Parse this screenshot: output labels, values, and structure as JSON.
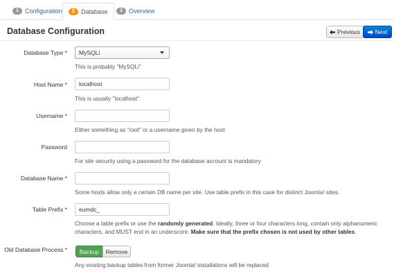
{
  "tabs": [
    {
      "number": "1",
      "label": "Configuration"
    },
    {
      "number": "2",
      "label": "Database"
    },
    {
      "number": "3",
      "label": "Overview"
    }
  ],
  "active_tab": "Database",
  "header": {
    "title": "Database Configuration",
    "previous_label": "Previous",
    "next_label": "Next"
  },
  "form": {
    "database_type": {
      "label": "Database Type *",
      "value": "MySQLi",
      "help": "This is probably \"MySQLi\""
    },
    "host_name": {
      "label": "Host Name *",
      "value": "localhost",
      "help": "This is usually \"localhost\""
    },
    "username": {
      "label": "Username *",
      "value": "",
      "help": "Either something as \"root\" or a username given by the host"
    },
    "password": {
      "label": "Password",
      "value": "",
      "help": "For site security using a password for the database account is mandatory"
    },
    "database_name": {
      "label": "Database Name *",
      "value": "",
      "help": "Some hosts allow only a certain DB name per site. Use table prefix in this case for distinct Joomla! sites."
    },
    "table_prefix": {
      "label": "Table Prefix *",
      "value": "eumdc_",
      "help_part1": "Choose a table prefix or use the ",
      "help_bold1": "randomly generated",
      "help_part2": ". Ideally, three or four characters long, contain only alphanumeric characters, and MUST end in an underscore. ",
      "help_bold2": "Make sure that the prefix chosen is not used by other tables",
      "help_part3": "."
    },
    "old_db_process": {
      "label": "Old Database Process *",
      "options": [
        "Backup",
        "Remove"
      ],
      "selected": "Backup",
      "help": "Any existing backup tables from former Joomla! installations will be replaced"
    }
  },
  "colors": {
    "link": "#2d6ca2",
    "primary": "#0055cc",
    "success": "#51a351",
    "step_active": "#f89406",
    "step_inactive": "#999999"
  }
}
